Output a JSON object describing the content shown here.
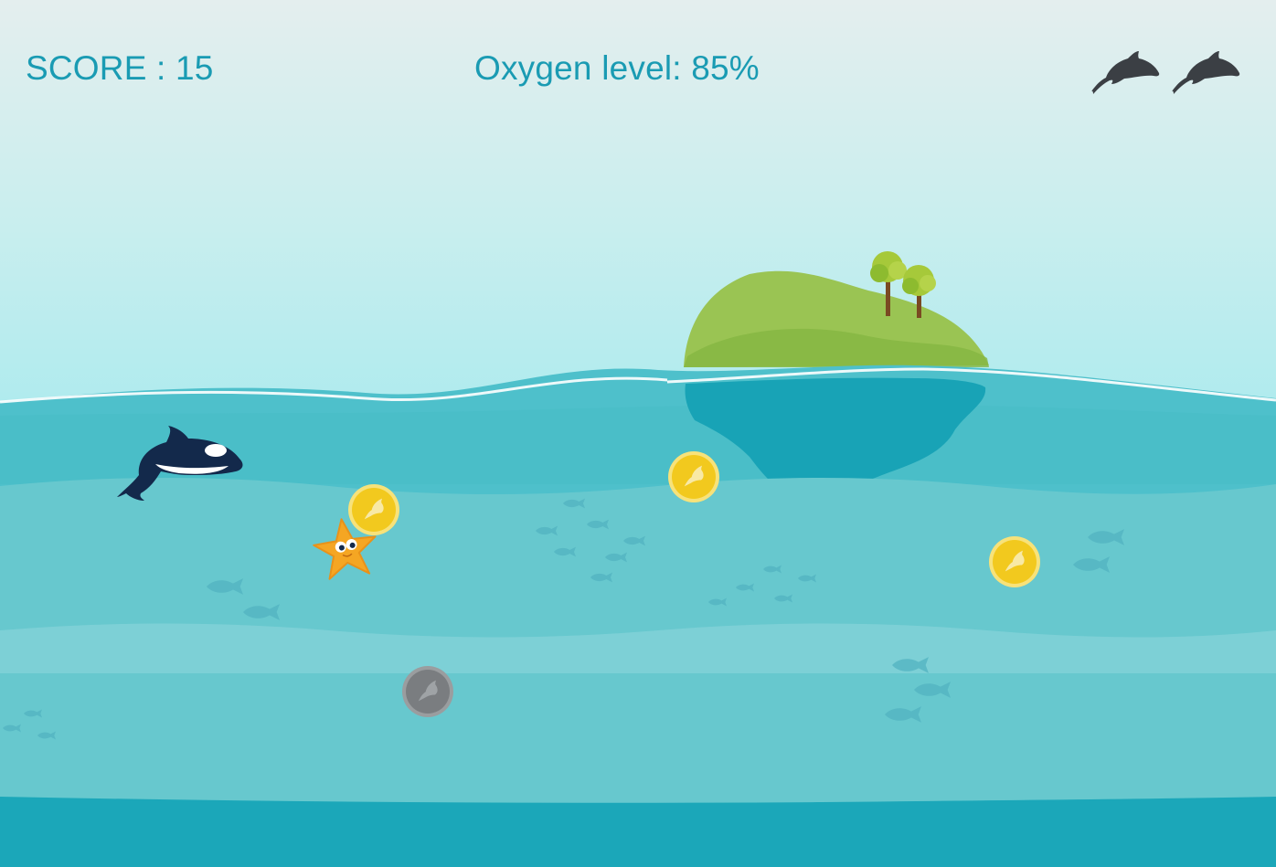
{
  "hud": {
    "score_label": "SCORE : 15",
    "score": 15,
    "oxygen_label": "Oxygen level: 85%",
    "oxygen_percent": 85
  },
  "lives": {
    "count": 2,
    "icon": "dolphin-icon",
    "color": "#3b3f44"
  },
  "colors": {
    "sky_top": "#e3eeee",
    "sky_bottom": "#b4ecee",
    "water_surface": "#4dc1cc",
    "water_mid": "#67c8ce",
    "water_band": "#7ed0d6",
    "water_deep": "#1ba7b9",
    "hud_text": "#1a9bb3",
    "island": "#8fbe4a",
    "coin": "#f2c91e",
    "coin_inactive": "#7a7d80",
    "orca": "#13294b",
    "starfish": "#f5a623"
  },
  "entities": {
    "player": "orca",
    "coins_active": 3,
    "coins_inactive": 1,
    "enemy": "starfish"
  }
}
